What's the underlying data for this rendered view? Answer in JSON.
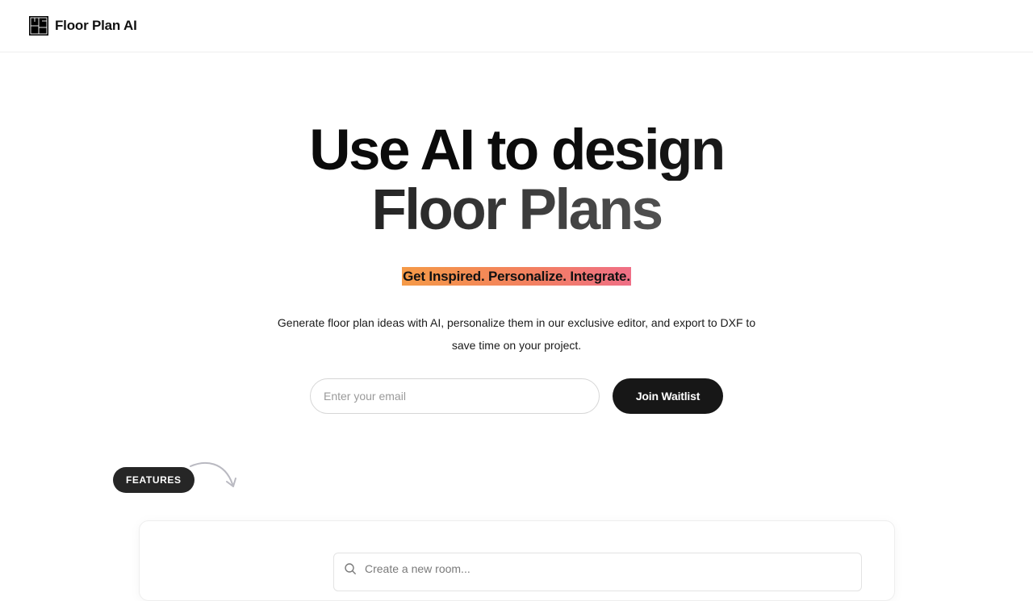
{
  "header": {
    "brand_name": "Floor Plan AI",
    "logo_icon": "floor-plan-icon"
  },
  "hero": {
    "title_line_1": "Use AI to design",
    "title_line_2": "Floor Plans",
    "tagline": "Get Inspired. Personalize. Integrate.",
    "description": "Generate floor plan ideas with AI, personalize them in our exclusive editor, and export to DXF to save time on your project."
  },
  "waitlist": {
    "email_placeholder": "Enter your email",
    "email_value": "",
    "join_label": "Join Waitlist"
  },
  "features": {
    "badge_label": "FEATURES",
    "arrow_icon": "curved-arrow-icon",
    "room_search": {
      "icon": "search-icon",
      "placeholder": "Create a new room..."
    }
  },
  "colors": {
    "button_bg": "#171717",
    "tagline_gradient_start": "#f59a47",
    "tagline_gradient_end": "#ef6f86",
    "badge_bg": "#262626"
  }
}
